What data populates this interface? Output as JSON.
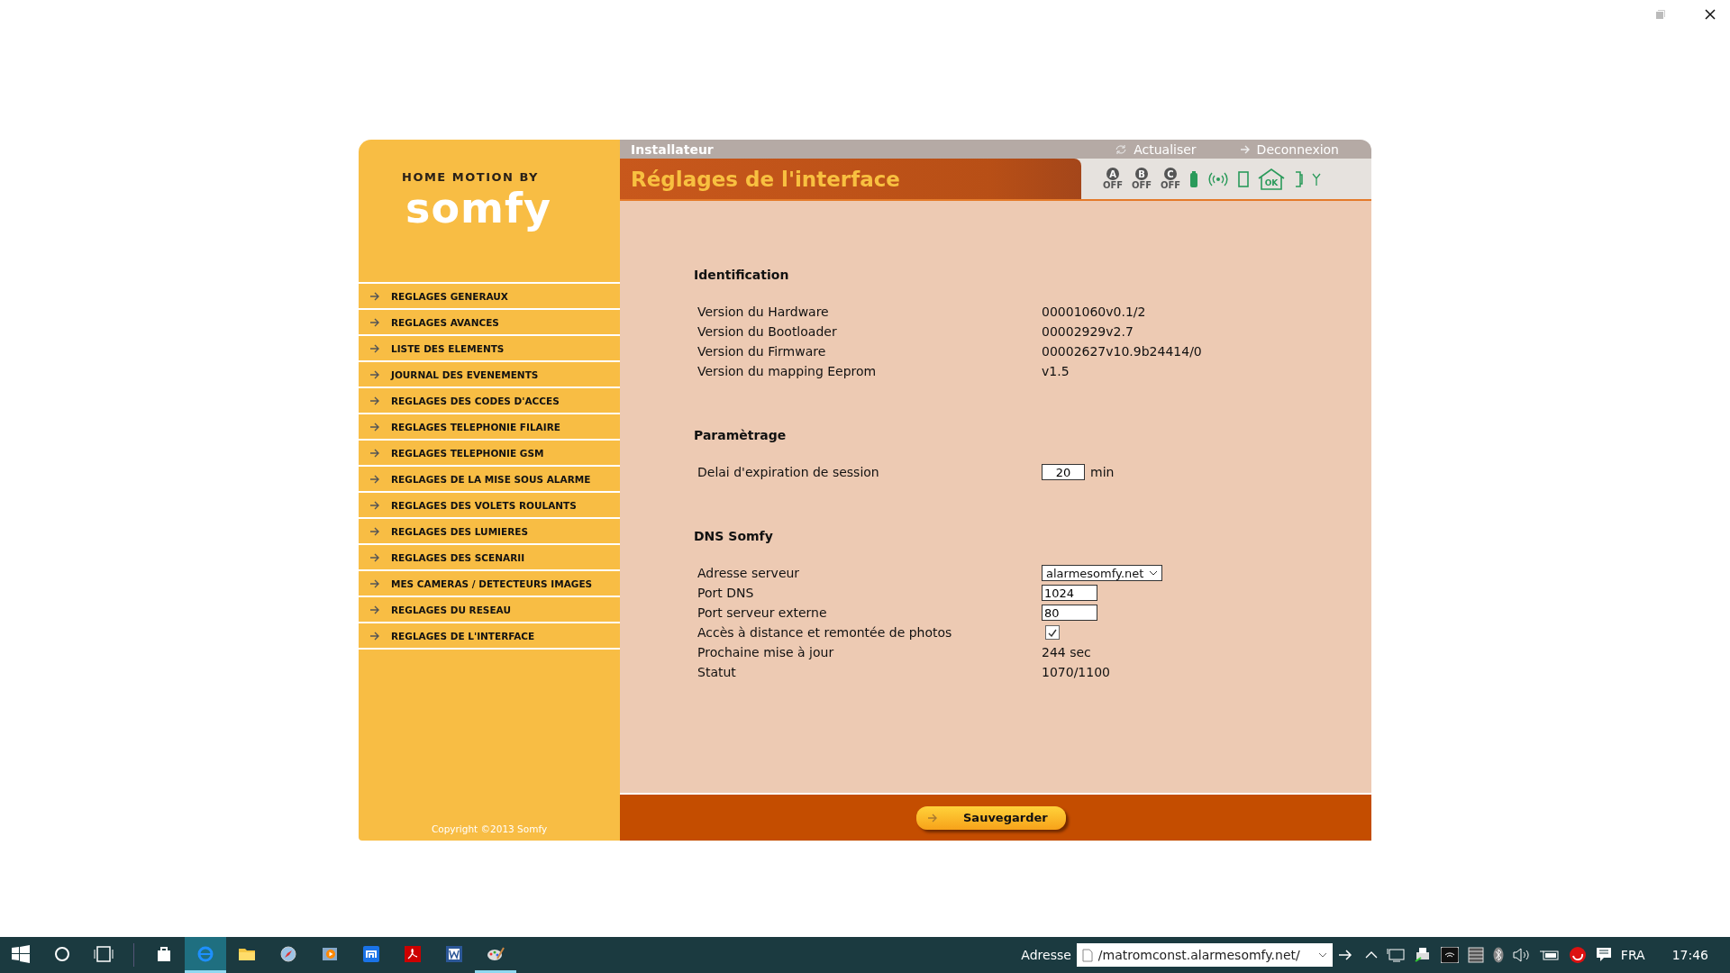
{
  "logo": {
    "tagline": "HOME MOTION BY",
    "brand": "somfy"
  },
  "menu": [
    {
      "label": "REGLAGES GENERAUX"
    },
    {
      "label": "REGLAGES AVANCES"
    },
    {
      "label": "LISTE DES ELEMENTS"
    },
    {
      "label": "JOURNAL DES EVENEMENTS"
    },
    {
      "label": "REGLAGES DES CODES D'ACCES"
    },
    {
      "label": "REGLAGES TELEPHONIE FILAIRE"
    },
    {
      "label": "REGLAGES TELEPHONIE GSM"
    },
    {
      "label": "REGLAGES DE LA MISE SOUS ALARME"
    },
    {
      "label": "REGLAGES DES VOLETS ROULANTS"
    },
    {
      "label": "REGLAGES DES LUMIERES"
    },
    {
      "label": "REGLAGES DES SCENARII"
    },
    {
      "label": "MES CAMERAS / DETECTEURS IMAGES"
    },
    {
      "label": "REGLAGES DU RESEAU"
    },
    {
      "label": "REGLAGES DE L'INTERFACE"
    }
  ],
  "copyright": "Copyright ©2013 Somfy",
  "topbar": {
    "user": "Installateur",
    "refresh": "Actualiser",
    "logout": "Deconnexion"
  },
  "page_title": "Réglages de l'interface",
  "zones": [
    {
      "letter": "A",
      "state": "OFF"
    },
    {
      "letter": "B",
      "state": "OFF"
    },
    {
      "letter": "C",
      "state": "OFF"
    }
  ],
  "house_label": "OK",
  "sections": [
    {
      "title": "Identification",
      "rows": [
        {
          "kind": "text",
          "label": "Version du Hardware",
          "value": "00001060v0.1/2"
        },
        {
          "kind": "text",
          "label": "Version du Bootloader",
          "value": "00002929v2.7"
        },
        {
          "kind": "text",
          "label": "Version du Firmware",
          "value": "00002627v10.9b24414/0"
        },
        {
          "kind": "text",
          "label": "Version du mapping Eeprom",
          "value": "v1.5"
        }
      ]
    },
    {
      "title": "Paramètrage",
      "rows": [
        {
          "kind": "number",
          "label": "Delai d'expiration de session",
          "value": "20",
          "unit": "min"
        }
      ]
    },
    {
      "title": "DNS Somfy",
      "rows": [
        {
          "kind": "select",
          "label": "Adresse serveur",
          "value": "alarmesomfy.net"
        },
        {
          "kind": "input",
          "label": "Port DNS",
          "value": "1024"
        },
        {
          "kind": "input",
          "label": "Port serveur externe",
          "value": "80"
        },
        {
          "kind": "checkbox",
          "label": "Accès à distance et remontée de photos",
          "checked": true
        },
        {
          "kind": "text",
          "label": "Prochaine mise à jour",
          "value": "244 sec"
        },
        {
          "kind": "text",
          "label": "Statut",
          "value": "1070/1100"
        }
      ]
    }
  ],
  "save_button": "Sauvegarder",
  "taskbar": {
    "apps": [
      {
        "kind": "store",
        "active": false,
        "running": false
      },
      {
        "kind": "browser",
        "active": true,
        "running": true
      },
      {
        "kind": "folder",
        "active": false,
        "running": false
      },
      {
        "kind": "compass",
        "active": false,
        "running": false
      },
      {
        "kind": "media",
        "active": false,
        "running": false
      },
      {
        "kind": "tile",
        "active": false,
        "running": false
      },
      {
        "kind": "pdf",
        "active": false,
        "running": false
      },
      {
        "kind": "doc",
        "active": false,
        "running": false
      },
      {
        "kind": "paint",
        "active": false,
        "running": true
      }
    ],
    "address_label": "Adresse",
    "address": "/matromconst.alarmesomfy.net/",
    "language": "FRA",
    "time": "17:46"
  }
}
